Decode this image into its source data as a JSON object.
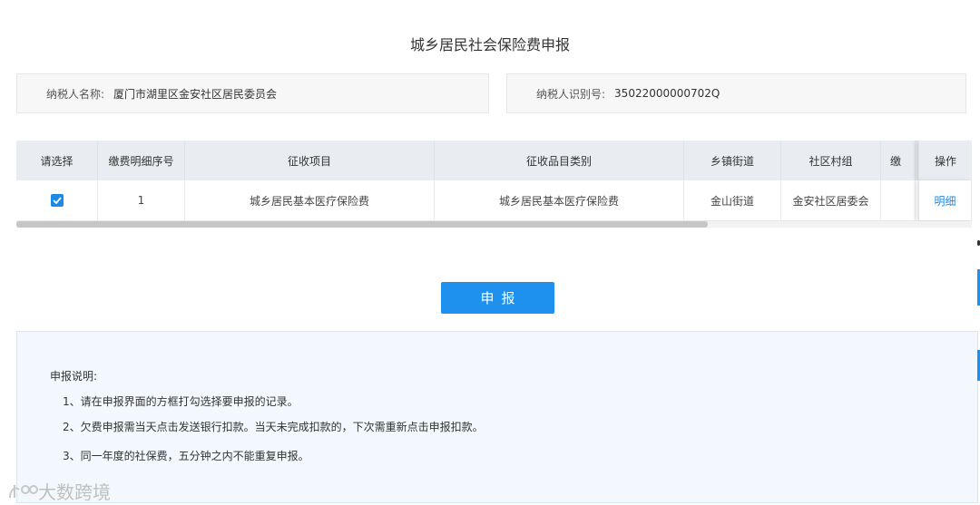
{
  "page": {
    "title": "城乡居民社会保险费申报"
  },
  "taxpayer": {
    "name_label": "纳税人名称:",
    "name_value": "厦门市湖里区金安社区居民委员会",
    "id_label": "纳税人识别号:",
    "id_value": "35022000000702Q"
  },
  "table": {
    "headers": [
      "请选择",
      "缴费明细序号",
      "征收项目",
      "征收品目类别",
      "乡镇街道",
      "社区村组",
      "缴",
      "操作"
    ],
    "rows": [
      {
        "checked": true,
        "seq": "1",
        "item": "城乡居民基本医疗保险费",
        "category": "城乡居民基本医疗保险费",
        "street": "金山街道",
        "community": "金安社区居委会",
        "extra": "",
        "action": "明细"
      }
    ],
    "horizontal_scroll_position": 0
  },
  "submit_label": "申报",
  "notes": {
    "title": "申报说明:",
    "items": [
      "1、请在申报界面的方框打勾选择要申报的记录。",
      "2、欠费申报需当天点击发送银行扣款。当天未完成扣款的，下次需重新点击申报扣款。",
      "3、同一年度的社保费，五分钟之内不能重复申报。"
    ]
  },
  "watermark": "大数跨境",
  "colors": {
    "primary": "#1e90ee",
    "header_bg": "#e9edf1",
    "notes_bg": "#f2f8fd",
    "link": "#1a8ae6"
  }
}
